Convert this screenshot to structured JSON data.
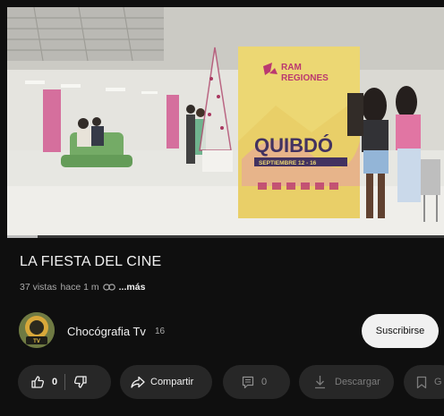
{
  "video": {
    "poster": {
      "line1": "RAM",
      "line2": "REGIONES",
      "city": "QUIBDÓ",
      "date": "SEPTIEMBRE 12 - 16"
    },
    "progress_percent": 7
  },
  "title": "LA FIESTA DEL CINE",
  "meta": {
    "views": "37 vistas",
    "age": "hace 1 m",
    "more": "...más"
  },
  "channel": {
    "name": "Chocógrafia Tv",
    "subscribers": "16",
    "subscribe_label": "Suscribirse"
  },
  "actions": {
    "like_count": "0",
    "share_label": "Compartir",
    "comment_count": "0",
    "download_label": "Descargar",
    "save_label": "G"
  },
  "icons": {
    "like": "thumbs-up-icon",
    "dislike": "thumbs-down-icon",
    "share": "share-arrow-icon",
    "comment": "comment-icon",
    "download": "download-icon",
    "save": "bookmark-icon",
    "link": "link-icon"
  },
  "colors": {
    "background": "#0f0f0f",
    "pill": "#272727",
    "subscribe": "#f1f1f1",
    "poster": "#ecd66e",
    "poster_magenta": "#b8306b"
  }
}
